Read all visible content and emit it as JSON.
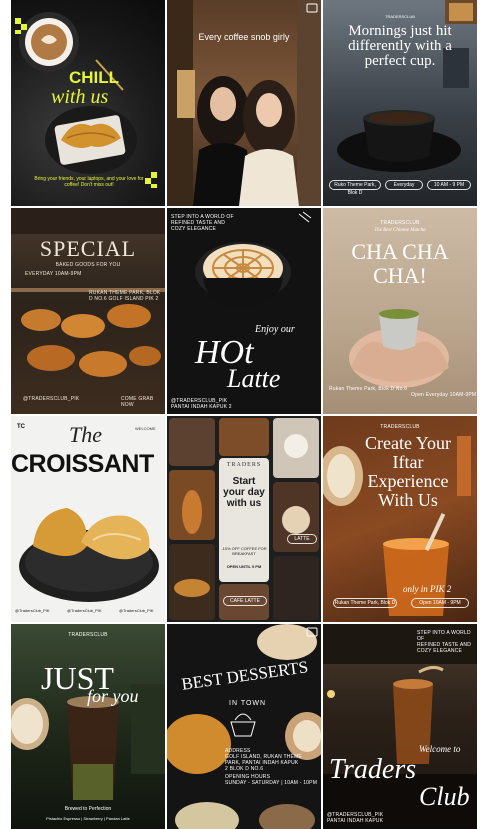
{
  "accent": {
    "lime": "#e7f53a",
    "white": "#ffffff",
    "caramel": "#c98a3e"
  },
  "posts": {
    "p1": {
      "title1": "CHILL",
      "title2": "with us",
      "caption": "Bring your friends, your laptops, and your love for coffee! Don't miss out!"
    },
    "p2": {
      "caption": "Every coffee snob girly"
    },
    "p3": {
      "brand": "TRADERSCLUB",
      "title": "Mornings just hit differently with a perfect cup.",
      "pill1": "Ruko Theme Park, Blok D",
      "pill2": "Everyday",
      "pill3": "10 AM - 9 PM"
    },
    "p4": {
      "title": "SPECIAL",
      "sub": "BAKED GOODS FOR YOU",
      "hours": "EVERYDAY 10AM-9PM",
      "addr": "RUKAN THEME PARK, BLOK D NO.6 GOLF ISLAND PIK 2",
      "handle": "@TRADERSCLUB_PIK",
      "cta": "COME GRAB NOW"
    },
    "p5": {
      "line1": "STEP INTO A WORLD OF",
      "line2": "REFINED TASTE AND",
      "line3": "COZY ELEGANCE",
      "enjoy": "Enjoy our",
      "hot": "HOt",
      "latte": "Latte",
      "handle": "@TRADERSCLUB_PIK",
      "place": "PANTAI INDAH KAPUK 2"
    },
    "p6": {
      "brand": "TRADERSCLUB",
      "tag": "The Best Chinese Matcha",
      "title": "CHA CHA CHA!",
      "addr": "Rukan Theme Park, Blok D No.6",
      "open": "Open Everyday 10AM-9PM"
    },
    "p7": {
      "brand": "TC",
      "welcome": "WELCOME",
      "the": "The",
      "title": "CROISSANT",
      "handle1": "@TradersClub_PIK",
      "handle2": "@TradersClub_PIK",
      "handle3": "@TradersClub_PIK"
    },
    "p8": {
      "brand": "TRADERS",
      "title": "Start your day with us",
      "offer": "-10% OFF COFFEE FOR BREAKFAST",
      "hours": "OPEN UNTIL 9 PM",
      "cta": "LATTE",
      "cta2": "CAFE LATTE"
    },
    "p9": {
      "brand": "TRADERSCLUB",
      "title": "Create Your Iftar Experience With Us",
      "sub": "only in PIK 2",
      "pill1": "Rukan Theme Park, Blok D",
      "pill2": "Open 10AM - 9PM"
    },
    "p10": {
      "brand": "TRADERSCLUB",
      "title1": "JUST",
      "title2": "for you",
      "tag": "Brewed to Perfection",
      "list": "Pistachio Espresso | Strawberry | Pandan Latte"
    },
    "p11": {
      "title": "BEST DESSERTS",
      "sub": "IN TOWN",
      "addr1": "ADDRESS",
      "addr2": "GOLF ISLAND, RUKAN THEME",
      "addr3": "PARK, PANTAI INDAH KAPUK",
      "addr4": "2 BLOK D NO.6",
      "hours1": "OPENING HOURS",
      "hours2": "SUNDAY - SATURDAY | 10AM - 10PM"
    },
    "p12": {
      "line1": "STEP INTO A WORLD OF",
      "line2": "REFINED TASTE AND",
      "line3": "COZY ELEGANCE",
      "welcome": "Welcome to",
      "traders": "Traders",
      "club": "Club",
      "handle": "@TRADERSCLUB_PIK",
      "place": "PANTAI INDAH KAPUK"
    }
  }
}
